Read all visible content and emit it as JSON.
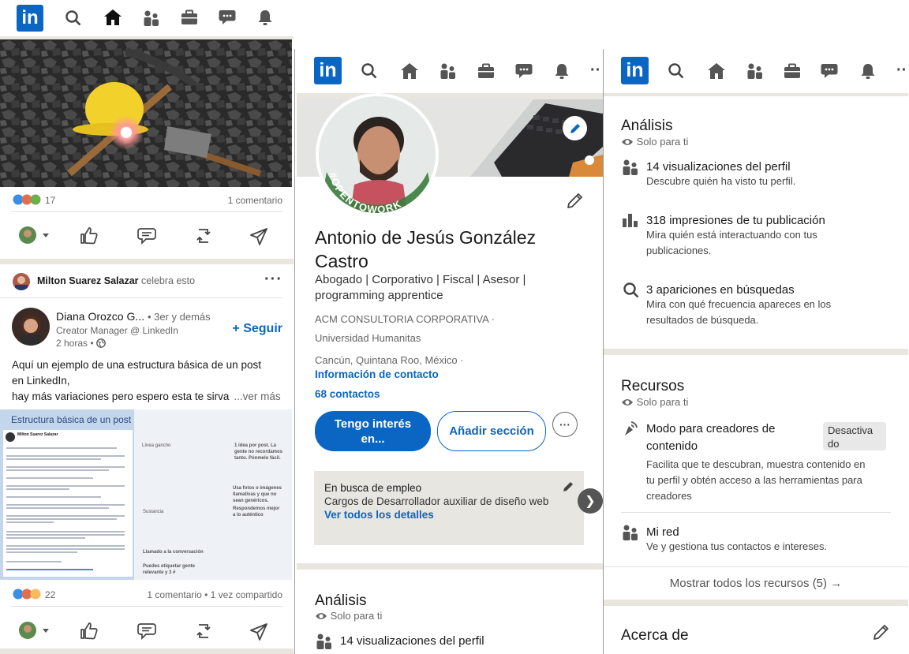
{
  "brand": {
    "logo_text": "in",
    "color": "#0a66c2"
  },
  "nav": {
    "icons": [
      "search-icon",
      "home-icon",
      "network-icon",
      "jobs-icon",
      "messaging-icon",
      "notifications-icon",
      "more-icon"
    ],
    "more": "··"
  },
  "feed": {
    "post1": {
      "reaction_count": "17",
      "comments": "1 comentario"
    },
    "post2": {
      "celebrator": "Milton Suarez Salazar",
      "celebrates": "celebra esto",
      "author_name": "Diana Orozco G...",
      "degree": "• 3er y demás",
      "headline": "Creator Manager @ LinkedIn",
      "time": "2 horas •",
      "follow": "+ Seguir",
      "text_line1": "Aquí un ejemplo de una estructura básica de un post",
      "text_line2": "en LinkedIn,",
      "text_line3": "hay más variaciones pero espero esta te sirva",
      "see_more": "...ver más",
      "image_title": "Estructura básica de un post",
      "image_author": "Milton Suarez Salazar",
      "image_labels": {
        "linea_gancho": "Línea gancho",
        "sustancia": "Sustancia",
        "llamado": "Llamado a la conversación",
        "idea": "1 idea por post. La gente no recordamos tanto. Pónmelo fácil.",
        "usa_fotos": "Usa fotos o imágenes llamativas y que no sean genéricos.",
        "respondemos": "Respondemos mejor a lo auténtico",
        "etiquetar": "Puedes etiquetar gente relevante y 3 #"
      },
      "reaction_count": "22",
      "stats": "1 comentario • 1 vez compartido"
    }
  },
  "profile": {
    "badge": "#OPENTOWORK",
    "name_line1": "Antonio de Jesús González",
    "name_line2": "Castro",
    "headline_line1": "Abogado | Corporativo | Fiscal | Asesor |",
    "headline_line2": "programming apprentice",
    "company": "ACM CONSULTORIA CORPORATIVA ·",
    "school": "Universidad Humanitas",
    "location": "Cancún, Quintana Roo, México ·",
    "contact_link": "Información de contacto",
    "connections": "68 contactos",
    "btn_interest_line1": "Tengo interés",
    "btn_interest_line2": "en...",
    "btn_add_section": "Añadir sección",
    "open_to_work_title": "En busca de empleo",
    "open_to_work_role": "Cargos de Desarrollador auxiliar de diseño web",
    "open_to_work_link": "Ver todos los detalles",
    "analytics_title": "Análisis",
    "analytics_private": "Solo para ti",
    "analytics_views": "14 visualizaciones del perfil"
  },
  "dashboard": {
    "analytics_title": "Análisis",
    "private": "Solo para ti",
    "views_title": "14 visualizaciones del perfil",
    "views_sub": "Descubre quién ha visto tu perfil.",
    "impressions_title": "318 impresiones de tu publicación",
    "impressions_sub1": "Mira quién está interactuando con tus",
    "impressions_sub2": "publicaciones.",
    "search_title": "3 apariciones en búsquedas",
    "search_sub1": "Mira con qué frecuencia apareces en los",
    "search_sub2": "resultados de búsqueda.",
    "resources_title": "Recursos",
    "resources_private": "Solo para ti",
    "creator_title1": "Modo para creadores de",
    "creator_title2": "contenido",
    "creator_badge1": "Desactiva",
    "creator_badge2": "do",
    "creator_sub1": "Facilita que te descubran, muestra contenido en",
    "creator_sub2": "tu perfil y obtén acceso a las herramientas para",
    "creator_sub3": "creadores",
    "network_title": "Mi red",
    "network_sub": "Ve y gestiona tus contactos e intereses.",
    "show_all": "Mostrar todos los recursos (5) →",
    "about_title": "Acerca de"
  }
}
